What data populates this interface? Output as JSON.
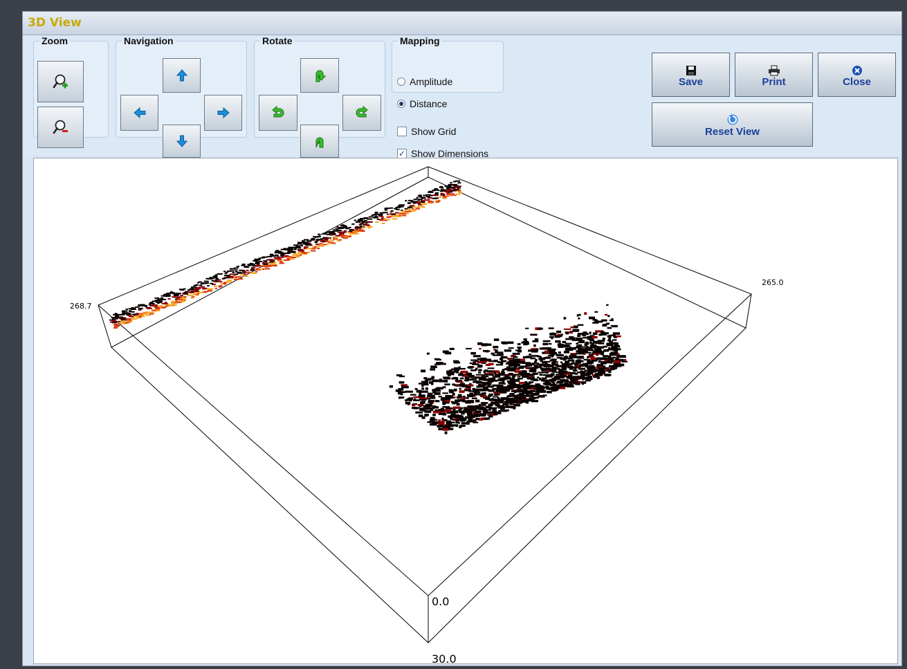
{
  "window": {
    "title": "3D View"
  },
  "groups": {
    "zoom": "Zoom",
    "navigation": "Navigation",
    "rotate": "Rotate",
    "mapping": "Mapping"
  },
  "mapping": {
    "options": [
      {
        "label": "Amplitude",
        "selected": false
      },
      {
        "label": "Distance",
        "selected": true
      }
    ]
  },
  "checkboxes": {
    "show_grid": {
      "label": "Show Grid",
      "checked": false
    },
    "show_dimensions": {
      "label": "Show Dimensions",
      "checked": true
    }
  },
  "actions": {
    "save": "Save",
    "print": "Print",
    "close": "Close",
    "reset_view": "Reset View"
  },
  "plot": {
    "labels": {
      "left": "268.7",
      "right": "265.0",
      "bottom_inner": "0.0",
      "bottom_outer": "30.0"
    },
    "colors": {
      "near_points": "#0a0000",
      "far_points_dark": "#8b0000",
      "far_points_mid": "#d8340c",
      "far_points_light": "#f7a21a",
      "box_lines": "#000000"
    }
  },
  "icons": {
    "zoom_in": "zoom-in-icon",
    "zoom_out": "zoom-out-icon",
    "arrow_up": "arrow-up-icon",
    "arrow_down": "arrow-down-icon",
    "arrow_left": "arrow-left-icon",
    "arrow_right": "arrow-right-icon",
    "save": "floppy-disk-icon",
    "print": "printer-icon",
    "close": "close-icon",
    "reset": "reset-icon"
  }
}
